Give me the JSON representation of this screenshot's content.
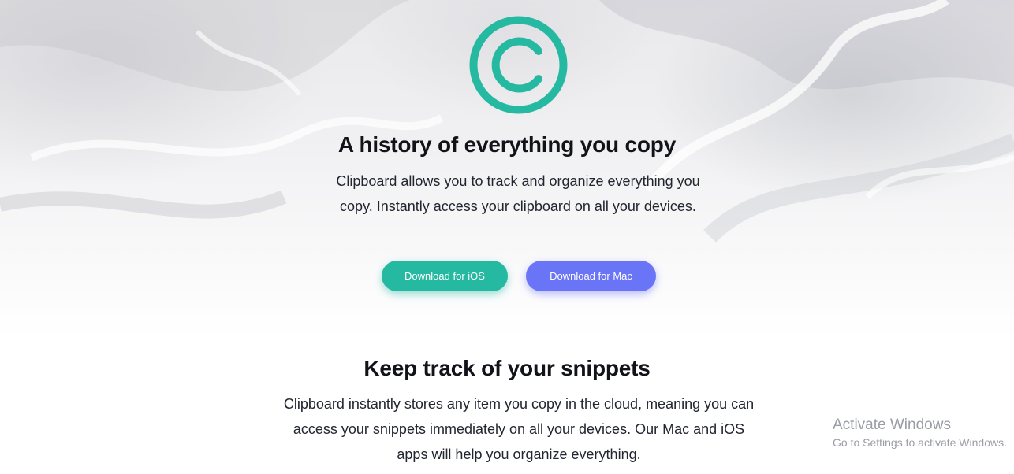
{
  "hero": {
    "logo_icon": "copyright-c-icon",
    "title": "A history of everything you copy",
    "description": "Clipboard allows you to track and organize everything you copy. Instantly access your clipboard on all your devices.",
    "buttons": {
      "ios_label": "Download for iOS",
      "mac_label": "Download for Mac"
    }
  },
  "features": {
    "title": "Keep track of your snippets",
    "description": "Clipboard instantly stores any item you copy in the cloud, meaning you can access your snippets immediately on all your devices. Our Mac and iOS apps will help you organize everything."
  },
  "watermark": {
    "title": "Activate Windows",
    "subtitle": "Go to Settings to activate Windows."
  },
  "colors": {
    "accent_teal": "#26b9a2",
    "accent_blue": "#6a74f7",
    "heading": "#111318"
  }
}
